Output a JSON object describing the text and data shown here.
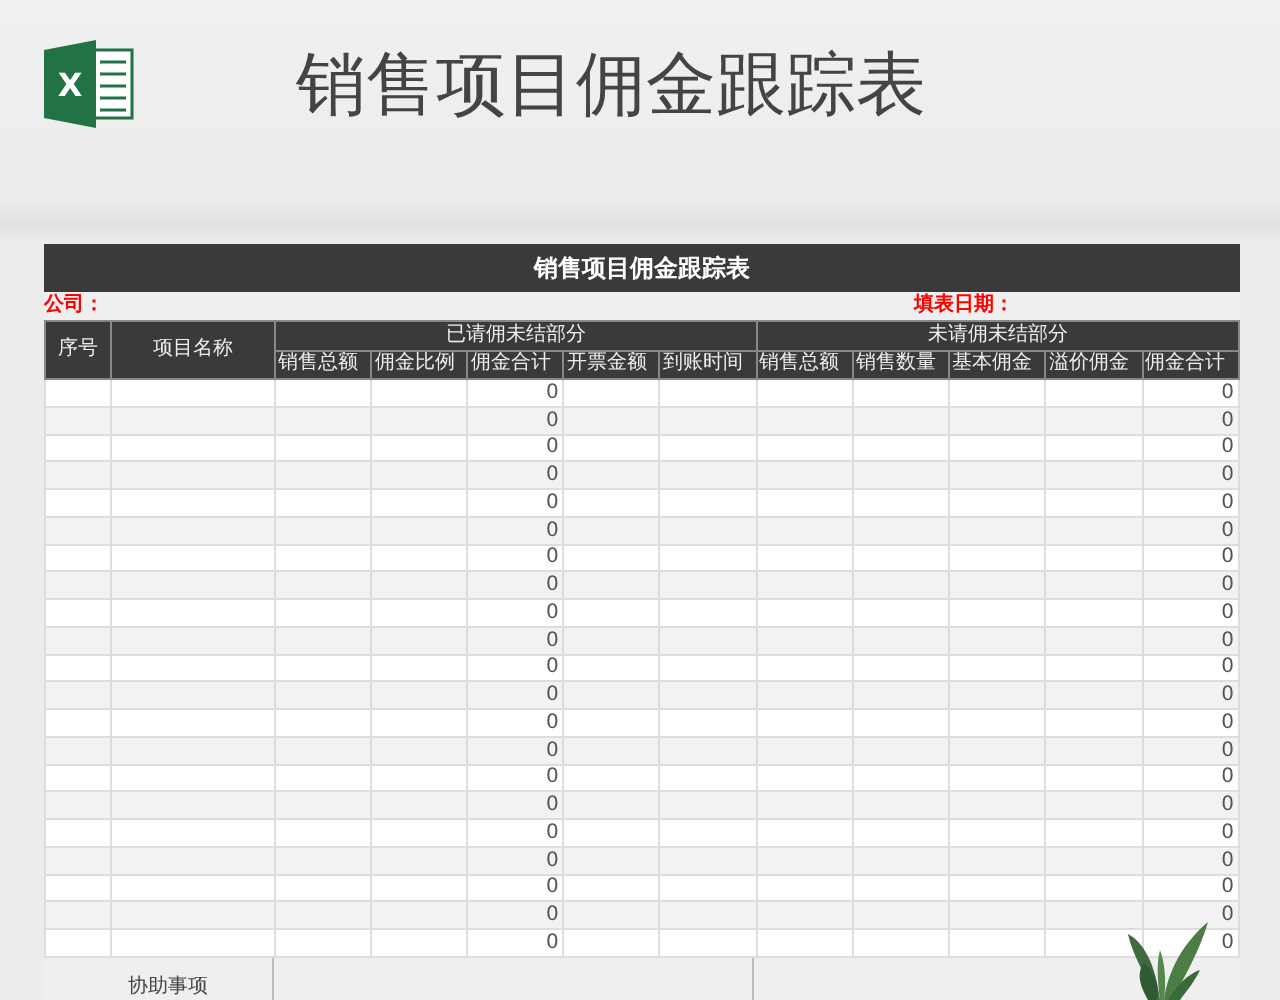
{
  "header": {
    "logo_letter": "X",
    "title": "销售项目佣金跟踪表"
  },
  "sheet": {
    "title": "销售项目佣金跟踪表",
    "company_label": "公司：",
    "date_label": "填表日期：",
    "columns": [
      "序号",
      "项目名称"
    ],
    "groups": [
      {
        "label": "已请佣未结部分",
        "columns": [
          {
            "label": "销售总额",
            "kind": "input"
          },
          {
            "label": "佣金比例",
            "kind": "input"
          },
          {
            "label": "佣金合计",
            "kind": "total"
          },
          {
            "label": "开票金额",
            "kind": "input"
          },
          {
            "label": "到账时间",
            "kind": "input"
          }
        ]
      },
      {
        "label": "未请佣未结部分",
        "columns": [
          {
            "label": "销售总额",
            "kind": "input"
          },
          {
            "label": "销售数量",
            "kind": "input"
          },
          {
            "label": "基本佣金",
            "kind": "input"
          },
          {
            "label": "溢价佣金",
            "kind": "input"
          },
          {
            "label": "佣金合计",
            "kind": "total"
          }
        ]
      }
    ],
    "rows": [
      {
        "claimed_total": "0",
        "unclaimed_total": "0"
      },
      {
        "claimed_total": "0",
        "unclaimed_total": "0"
      },
      {
        "claimed_total": "0",
        "unclaimed_total": "0"
      },
      {
        "claimed_total": "0",
        "unclaimed_total": "0"
      },
      {
        "claimed_total": "0",
        "unclaimed_total": "0"
      },
      {
        "claimed_total": "0",
        "unclaimed_total": "0"
      },
      {
        "claimed_total": "0",
        "unclaimed_total": "0"
      },
      {
        "claimed_total": "0",
        "unclaimed_total": "0"
      },
      {
        "claimed_total": "0",
        "unclaimed_total": "0"
      },
      {
        "claimed_total": "0",
        "unclaimed_total": "0"
      },
      {
        "claimed_total": "0",
        "unclaimed_total": "0"
      },
      {
        "claimed_total": "0",
        "unclaimed_total": "0"
      },
      {
        "claimed_total": "0",
        "unclaimed_total": "0"
      },
      {
        "claimed_total": "0",
        "unclaimed_total": "0"
      },
      {
        "claimed_total": "0",
        "unclaimed_total": "0"
      },
      {
        "claimed_total": "0",
        "unclaimed_total": "0"
      },
      {
        "claimed_total": "0",
        "unclaimed_total": "0"
      },
      {
        "claimed_total": "0",
        "unclaimed_total": "0"
      },
      {
        "claimed_total": "0",
        "unclaimed_total": "0"
      },
      {
        "claimed_total": "0",
        "unclaimed_total": "0"
      },
      {
        "claimed_total": "0",
        "unclaimed_total": "0"
      }
    ],
    "footer_label": "协助事项"
  }
}
